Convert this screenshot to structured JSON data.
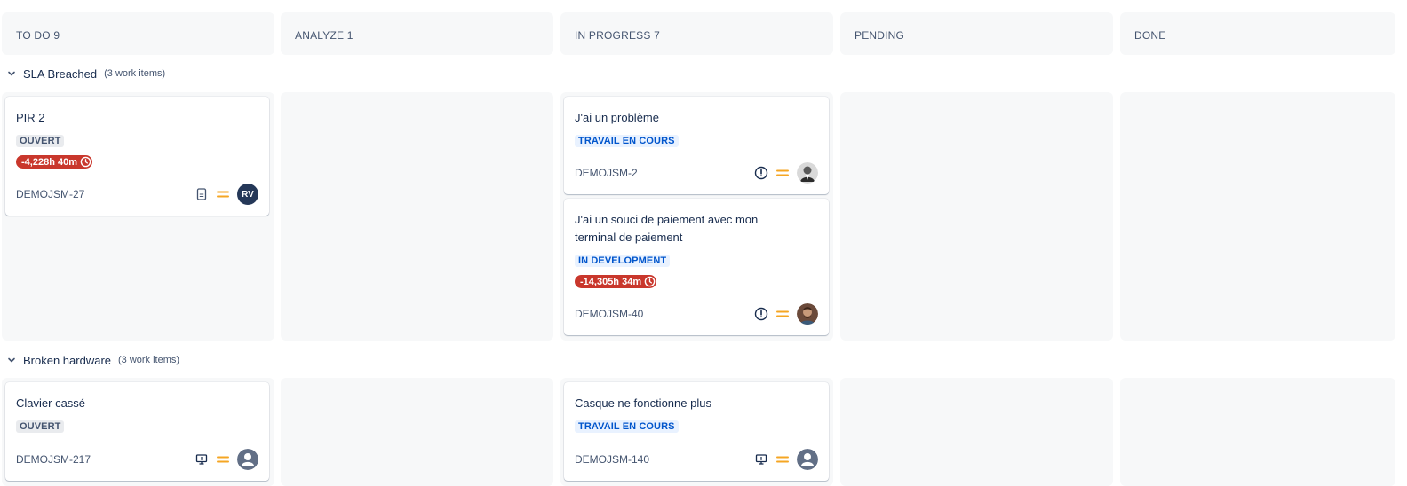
{
  "columns": [
    {
      "label": "TO DO 9"
    },
    {
      "label": "ANALYZE 1"
    },
    {
      "label": "IN PROGRESS 7"
    },
    {
      "label": "PENDING"
    },
    {
      "label": "DONE"
    }
  ],
  "swimlanes": [
    {
      "title": "SLA Breached",
      "count": "(3 work items)"
    },
    {
      "title": "Broken hardware",
      "count": "(3 work items)"
    }
  ],
  "cards": [
    {
      "title": "PIR 2",
      "status": "OUVERT",
      "sla": "-4,228h 40m",
      "key": "DEMOJSM-27",
      "type_icon": "document-icon",
      "priority_icon": "medium-priority-icon",
      "assignee_initials": "RV"
    },
    {
      "title": "J'ai un problème",
      "status": "TRAVAIL EN COURS",
      "key": "DEMOJSM-2",
      "type_icon": "alert-icon",
      "priority_icon": "medium-priority-icon",
      "assignee": "avatar-photo"
    },
    {
      "title": "J'ai un souci de paiement avec mon terminal de paiement",
      "status": "IN DEVELOPMENT",
      "sla": "-14,305h 34m",
      "key": "DEMOJSM-40",
      "type_icon": "alert-icon",
      "priority_icon": "medium-priority-icon",
      "assignee": "avatar-photo"
    },
    {
      "title": "Clavier cassé",
      "status": "OUVERT",
      "key": "DEMOJSM-217",
      "type_icon": "monitor-icon",
      "priority_icon": "medium-priority-icon",
      "assignee": "default-avatar"
    },
    {
      "title": "Casque ne fonctionne plus",
      "status": "TRAVAIL EN COURS",
      "key": "DEMOJSM-140",
      "type_icon": "monitor-icon",
      "priority_icon": "medium-priority-icon",
      "assignee": "default-avatar"
    }
  ],
  "colors": {
    "column_bg": "#f7f8f9",
    "sla_red": "#c9372c",
    "priority_orange": "#f5a623",
    "lozenge_blue": "#0055cc",
    "avatar_navy": "#253858"
  }
}
